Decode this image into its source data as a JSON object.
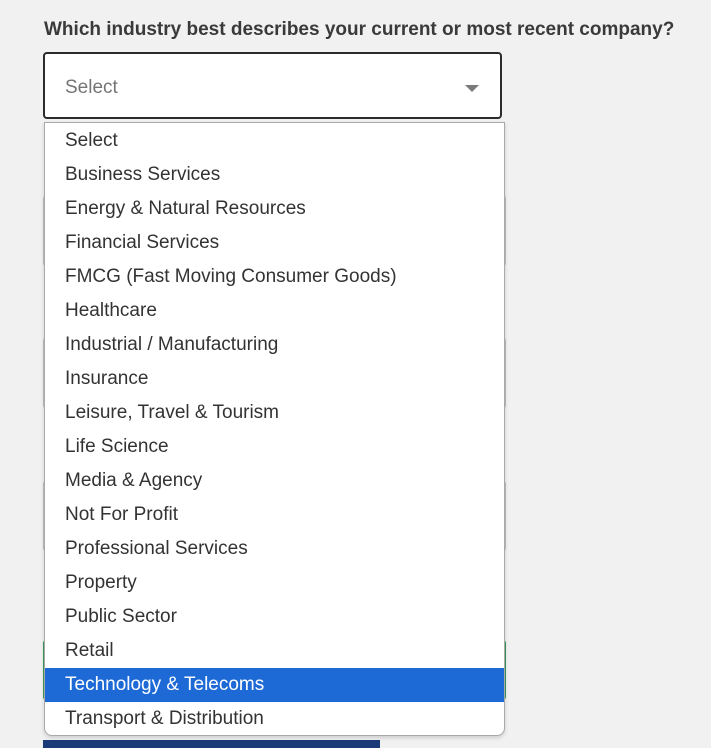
{
  "question": "Which industry best describes your current or most recent company?",
  "select": {
    "value": "Select",
    "highlighted_index": 16
  },
  "dropdown": {
    "options": [
      "Select",
      "Business Services",
      "Energy & Natural Resources",
      "Financial Services",
      "FMCG (Fast Moving Consumer Goods)",
      "Healthcare",
      "Industrial / Manufacturing",
      "Insurance",
      "Leisure, Travel & Tourism",
      "Life Science",
      "Media & Agency",
      "Not For Profit",
      "Professional Services",
      "Property",
      "Public Sector",
      "Retail",
      "Technology & Telecoms",
      "Transport & Distribution"
    ]
  },
  "colors": {
    "highlight": "#1d6ad6",
    "border": "#2b2b2b",
    "background": "#f1f1f1"
  }
}
